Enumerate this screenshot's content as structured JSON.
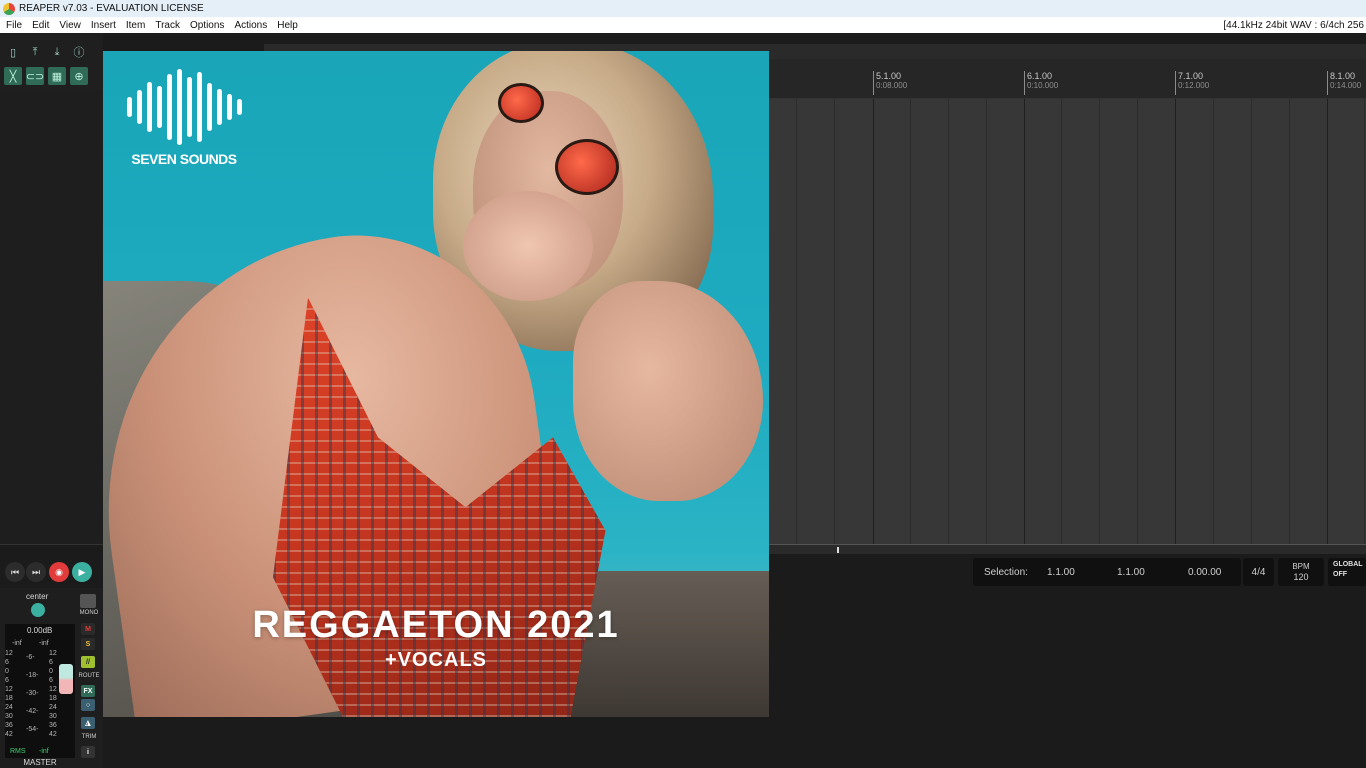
{
  "window": {
    "title": "REAPER v7.03 - EVALUATION LICENSE"
  },
  "menu": {
    "items": [
      "File",
      "Edit",
      "View",
      "Insert",
      "Item",
      "Track",
      "Options",
      "Actions",
      "Help"
    ],
    "status": "[44.1kHz 24bit WAV : 6/4ch 256"
  },
  "ruler": {
    "markers": [
      {
        "bar": "5.1.00",
        "time": "0:08.000"
      },
      {
        "bar": "6.1.00",
        "time": "0:10.000"
      },
      {
        "bar": "7.1.00",
        "time": "0:12.000"
      },
      {
        "bar": "8.1.00",
        "time": "0:14.000"
      }
    ]
  },
  "selection": {
    "label": "Selection:",
    "start": "1.1.00",
    "end": "1.1.00",
    "length": "0.00.00"
  },
  "timesig": "4/4",
  "tempo": {
    "label": "BPM",
    "value": "120"
  },
  "global": {
    "label": "GLOBAL",
    "state": "OFF"
  },
  "master": {
    "pan": "center",
    "volume": "0.00dB",
    "peak_left": "-inf",
    "peak_right": "-inf",
    "rms_label": "RMS",
    "rms_value": "-inf",
    "name": "MASTER",
    "scale_left": [
      "12",
      "6",
      "0",
      "6",
      "12",
      "18",
      "24",
      "30",
      "36",
      "42"
    ],
    "scale_mid": [
      "-6-",
      "-18-",
      "-30-",
      "-42-",
      "-54-"
    ],
    "scale_right": [
      "12",
      "6",
      "0",
      "6",
      "12",
      "18",
      "24",
      "30",
      "36",
      "42"
    ],
    "buttons": {
      "mono": "MONO",
      "mute": "M",
      "solo": "S",
      "route": "ROUTE",
      "fx": "FX",
      "trim": "TRIM",
      "info": "i"
    }
  },
  "artwork": {
    "brand": "SEVEN SOUNDS",
    "title": "REGGAETON 2021",
    "subtitle": "+VOCALS"
  },
  "colors": {
    "accent_teal": "#2f6b56",
    "record": "#e23b3b",
    "play": "#3bb0a0"
  }
}
